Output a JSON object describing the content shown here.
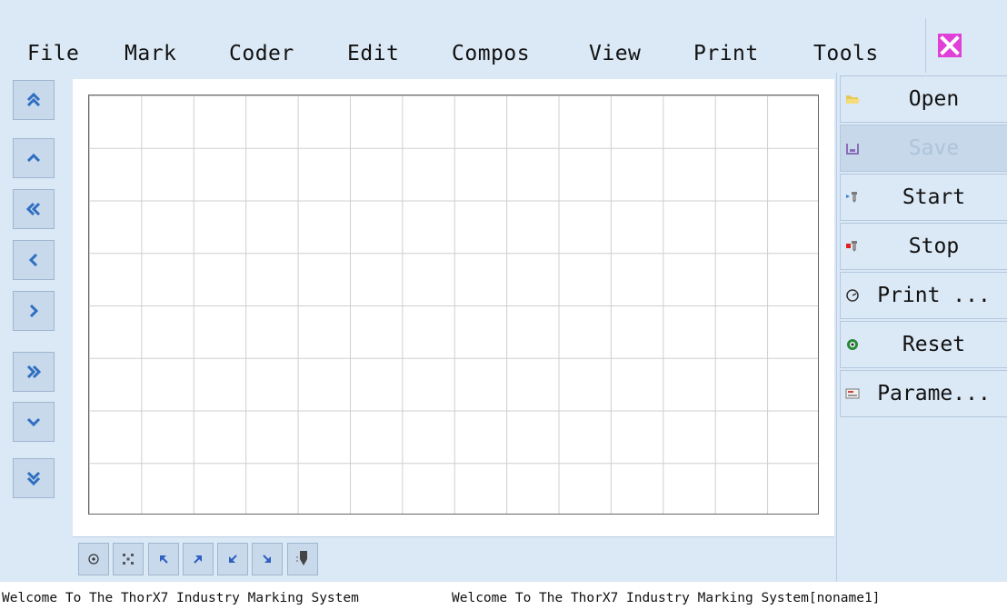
{
  "menu": {
    "items": [
      "File",
      "Mark",
      "Coder",
      "Edit",
      "Compos",
      "View",
      "Print",
      "Tools"
    ]
  },
  "window": {
    "close_icon": "close-x-icon"
  },
  "left_nav": {
    "buttons": [
      {
        "name": "scroll-up-fast-icon"
      },
      {
        "name": "scroll-up-icon"
      },
      {
        "name": "scroll-left-fast-icon"
      },
      {
        "name": "scroll-left-icon"
      },
      {
        "name": "scroll-right-icon"
      },
      {
        "name": "scroll-right-fast-icon"
      },
      {
        "name": "scroll-down-icon"
      },
      {
        "name": "scroll-down-fast-icon"
      }
    ]
  },
  "toolbar": {
    "buttons": [
      "target-icon",
      "scatter-icon",
      "arrow-up-left-icon",
      "arrow-up-right-icon",
      "arrow-down-left-icon",
      "arrow-down-right-icon",
      "print-head-icon"
    ]
  },
  "side_buttons": {
    "open": {
      "label": "Open",
      "icon": "folder-open-icon"
    },
    "save": {
      "label": "Save",
      "icon": "save-disk-icon",
      "disabled": true
    },
    "start": {
      "label": "Start",
      "icon": "start-icon"
    },
    "stop": {
      "label": "Stop",
      "icon": "stop-icon"
    },
    "print": {
      "label": "Print ...",
      "icon": "print-gauge-icon"
    },
    "reset": {
      "label": "Reset",
      "icon": "reset-icon"
    },
    "params": {
      "label": "Parame...",
      "icon": "parameters-icon"
    }
  },
  "status": {
    "left": "Welcome To The ThorX7 Industry Marking System",
    "right": "Welcome To The ThorX7 Industry Marking System[noname1]"
  },
  "colors": {
    "background": "#dbe8f5",
    "button": "#c8d9ec",
    "arrow": "#2f6fc0",
    "close": "#e040d8"
  }
}
